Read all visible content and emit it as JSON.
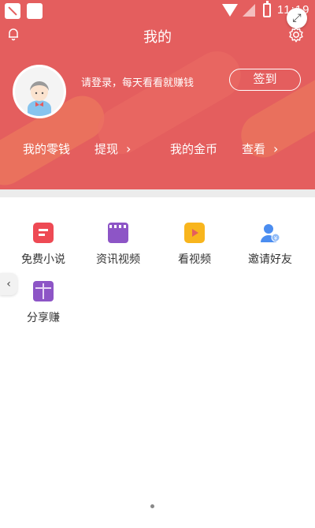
{
  "status_bar": {
    "time": "11:19"
  },
  "header": {
    "title": "我的",
    "login_prompt": "请登录，每天看看就赚钱",
    "checkin_label": "签到",
    "stats": [
      {
        "label": "我的零钱"
      },
      {
        "label": "提现",
        "chevron": "›"
      },
      {
        "label": "我的金币"
      },
      {
        "label": "查看",
        "chevron": "›"
      }
    ]
  },
  "grid": [
    {
      "label": "免费小说",
      "icon": "novel-icon"
    },
    {
      "label": "资讯视频",
      "icon": "video-news-icon"
    },
    {
      "label": "看视频",
      "icon": "watch-video-icon"
    },
    {
      "label": "邀请好友",
      "icon": "invite-friends-icon"
    },
    {
      "label": "分享赚",
      "icon": "share-earn-icon"
    }
  ],
  "colors": {
    "header_bg": "#e45e5e",
    "strip": "#ececec"
  }
}
